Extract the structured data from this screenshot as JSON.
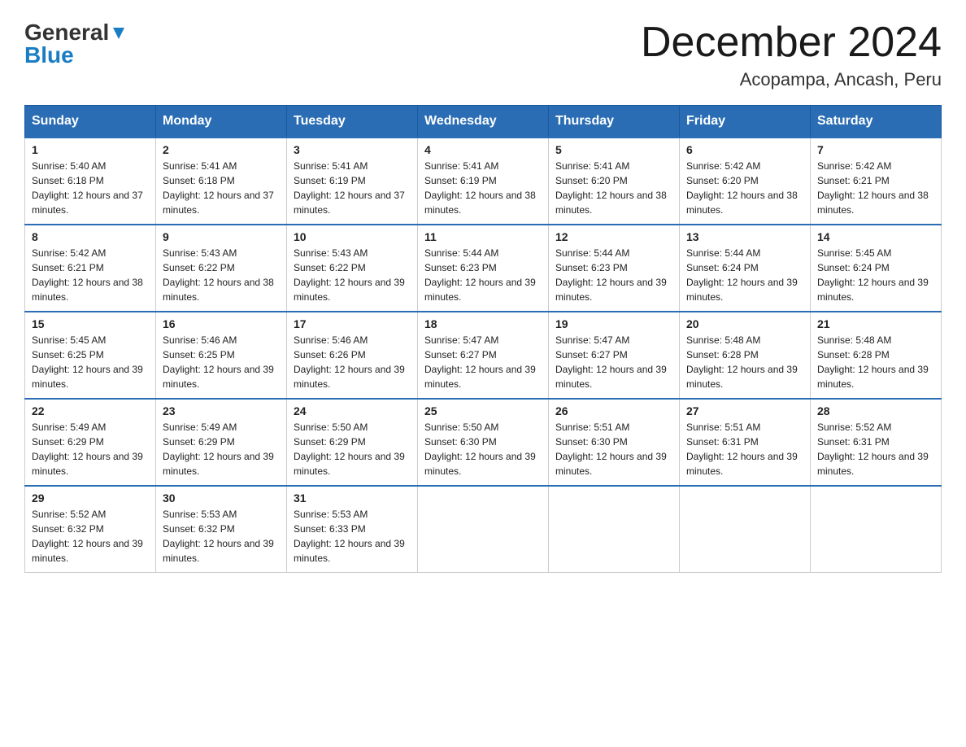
{
  "header": {
    "logo_general": "General",
    "logo_blue": "Blue",
    "title": "December 2024",
    "subtitle": "Acopampa, Ancash, Peru"
  },
  "days_of_week": [
    "Sunday",
    "Monday",
    "Tuesday",
    "Wednesday",
    "Thursday",
    "Friday",
    "Saturday"
  ],
  "weeks": [
    [
      {
        "day": "1",
        "sunrise": "5:40 AM",
        "sunset": "6:18 PM",
        "daylight": "12 hours and 37 minutes."
      },
      {
        "day": "2",
        "sunrise": "5:41 AM",
        "sunset": "6:18 PM",
        "daylight": "12 hours and 37 minutes."
      },
      {
        "day": "3",
        "sunrise": "5:41 AM",
        "sunset": "6:19 PM",
        "daylight": "12 hours and 37 minutes."
      },
      {
        "day": "4",
        "sunrise": "5:41 AM",
        "sunset": "6:19 PM",
        "daylight": "12 hours and 38 minutes."
      },
      {
        "day": "5",
        "sunrise": "5:41 AM",
        "sunset": "6:20 PM",
        "daylight": "12 hours and 38 minutes."
      },
      {
        "day": "6",
        "sunrise": "5:42 AM",
        "sunset": "6:20 PM",
        "daylight": "12 hours and 38 minutes."
      },
      {
        "day": "7",
        "sunrise": "5:42 AM",
        "sunset": "6:21 PM",
        "daylight": "12 hours and 38 minutes."
      }
    ],
    [
      {
        "day": "8",
        "sunrise": "5:42 AM",
        "sunset": "6:21 PM",
        "daylight": "12 hours and 38 minutes."
      },
      {
        "day": "9",
        "sunrise": "5:43 AM",
        "sunset": "6:22 PM",
        "daylight": "12 hours and 38 minutes."
      },
      {
        "day": "10",
        "sunrise": "5:43 AM",
        "sunset": "6:22 PM",
        "daylight": "12 hours and 39 minutes."
      },
      {
        "day": "11",
        "sunrise": "5:44 AM",
        "sunset": "6:23 PM",
        "daylight": "12 hours and 39 minutes."
      },
      {
        "day": "12",
        "sunrise": "5:44 AM",
        "sunset": "6:23 PM",
        "daylight": "12 hours and 39 minutes."
      },
      {
        "day": "13",
        "sunrise": "5:44 AM",
        "sunset": "6:24 PM",
        "daylight": "12 hours and 39 minutes."
      },
      {
        "day": "14",
        "sunrise": "5:45 AM",
        "sunset": "6:24 PM",
        "daylight": "12 hours and 39 minutes."
      }
    ],
    [
      {
        "day": "15",
        "sunrise": "5:45 AM",
        "sunset": "6:25 PM",
        "daylight": "12 hours and 39 minutes."
      },
      {
        "day": "16",
        "sunrise": "5:46 AM",
        "sunset": "6:25 PM",
        "daylight": "12 hours and 39 minutes."
      },
      {
        "day": "17",
        "sunrise": "5:46 AM",
        "sunset": "6:26 PM",
        "daylight": "12 hours and 39 minutes."
      },
      {
        "day": "18",
        "sunrise": "5:47 AM",
        "sunset": "6:27 PM",
        "daylight": "12 hours and 39 minutes."
      },
      {
        "day": "19",
        "sunrise": "5:47 AM",
        "sunset": "6:27 PM",
        "daylight": "12 hours and 39 minutes."
      },
      {
        "day": "20",
        "sunrise": "5:48 AM",
        "sunset": "6:28 PM",
        "daylight": "12 hours and 39 minutes."
      },
      {
        "day": "21",
        "sunrise": "5:48 AM",
        "sunset": "6:28 PM",
        "daylight": "12 hours and 39 minutes."
      }
    ],
    [
      {
        "day": "22",
        "sunrise": "5:49 AM",
        "sunset": "6:29 PM",
        "daylight": "12 hours and 39 minutes."
      },
      {
        "day": "23",
        "sunrise": "5:49 AM",
        "sunset": "6:29 PM",
        "daylight": "12 hours and 39 minutes."
      },
      {
        "day": "24",
        "sunrise": "5:50 AM",
        "sunset": "6:29 PM",
        "daylight": "12 hours and 39 minutes."
      },
      {
        "day": "25",
        "sunrise": "5:50 AM",
        "sunset": "6:30 PM",
        "daylight": "12 hours and 39 minutes."
      },
      {
        "day": "26",
        "sunrise": "5:51 AM",
        "sunset": "6:30 PM",
        "daylight": "12 hours and 39 minutes."
      },
      {
        "day": "27",
        "sunrise": "5:51 AM",
        "sunset": "6:31 PM",
        "daylight": "12 hours and 39 minutes."
      },
      {
        "day": "28",
        "sunrise": "5:52 AM",
        "sunset": "6:31 PM",
        "daylight": "12 hours and 39 minutes."
      }
    ],
    [
      {
        "day": "29",
        "sunrise": "5:52 AM",
        "sunset": "6:32 PM",
        "daylight": "12 hours and 39 minutes."
      },
      {
        "day": "30",
        "sunrise": "5:53 AM",
        "sunset": "6:32 PM",
        "daylight": "12 hours and 39 minutes."
      },
      {
        "day": "31",
        "sunrise": "5:53 AM",
        "sunset": "6:33 PM",
        "daylight": "12 hours and 39 minutes."
      },
      null,
      null,
      null,
      null
    ]
  ],
  "sunrise_label": "Sunrise: ",
  "sunset_label": "Sunset: ",
  "daylight_label": "Daylight: "
}
